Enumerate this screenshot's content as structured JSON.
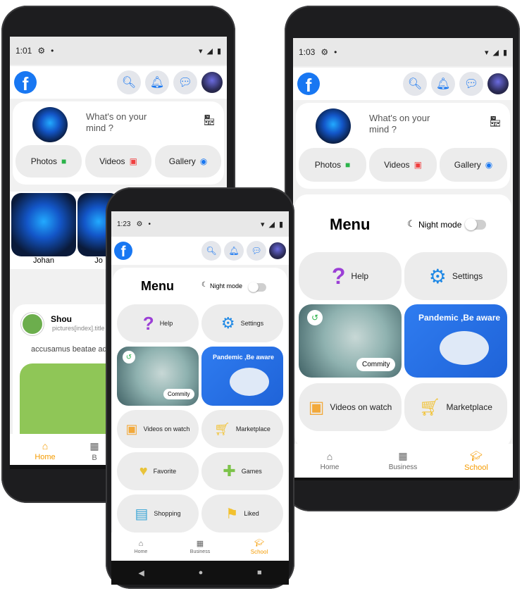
{
  "accent": "#f59b00",
  "fb_blue": "#1877f2",
  "phones": {
    "left": {
      "time": "1:01",
      "composer_placeholder": "What's on your mind ?",
      "shortcuts": [
        {
          "label": "Photos",
          "icon": "camera-icon",
          "color": "#2bb34a"
        },
        {
          "label": "Videos",
          "icon": "video-icon",
          "color": "#f03e3e"
        },
        {
          "label": "Gallery",
          "icon": "eye-icon",
          "color": "#1877f2"
        }
      ],
      "stories": [
        {
          "name": "Johan"
        },
        {
          "name": "Jo"
        }
      ],
      "post": {
        "author": "Shou",
        "subtitle": "pictures[index].title",
        "text": "accusamus beatae ad"
      },
      "nav": [
        {
          "label": "Home",
          "active": true
        },
        {
          "label": "B",
          "active": false
        }
      ]
    },
    "center": {
      "time": "1:23",
      "menu_title": "Menu",
      "night_mode_label": "Night mode",
      "items": [
        {
          "label": "Help",
          "icon": "question-icon"
        },
        {
          "label": "Settings",
          "icon": "gear-icon"
        },
        {
          "label": "Commity",
          "icon": "history-icon"
        },
        {
          "label": "Pandemic ,Be aware",
          "icon": "pandemic-illustration"
        },
        {
          "label": "Videos on watch",
          "icon": "video-frame-icon"
        },
        {
          "label": "Marketplace",
          "icon": "cart-icon"
        },
        {
          "label": "Favorite",
          "icon": "heart-icon"
        },
        {
          "label": "Games",
          "icon": "gamepad-icon"
        },
        {
          "label": "Shopping",
          "icon": "shopping-bag-icon"
        },
        {
          "label": "Liked",
          "icon": "flag-icon"
        }
      ],
      "nav": [
        {
          "label": "Home",
          "active": false
        },
        {
          "label": "Business",
          "active": false
        },
        {
          "label": "School",
          "active": true
        }
      ]
    },
    "right": {
      "time": "1:03",
      "composer_placeholder": "What's on your mind ?",
      "shortcuts": [
        {
          "label": "Photos",
          "icon": "camera-icon",
          "color": "#2bb34a"
        },
        {
          "label": "Videos",
          "icon": "video-icon",
          "color": "#f03e3e"
        },
        {
          "label": "Gallery",
          "icon": "eye-icon",
          "color": "#1877f2"
        }
      ],
      "menu_title": "Menu",
      "night_mode_label": "Night mode",
      "items": [
        {
          "label": "Help",
          "icon": "question-icon"
        },
        {
          "label": "Settings",
          "icon": "gear-icon"
        },
        {
          "label": "Commity",
          "icon": "history-icon"
        },
        {
          "label": "Pandemic ,Be aware",
          "icon": "pandemic-illustration"
        },
        {
          "label": "Videos on watch",
          "icon": "video-frame-icon"
        },
        {
          "label": "Marketplace",
          "icon": "cart-icon"
        }
      ],
      "nav": [
        {
          "label": "Home",
          "active": false
        },
        {
          "label": "Business",
          "active": false
        },
        {
          "label": "School",
          "active": true
        }
      ]
    }
  }
}
